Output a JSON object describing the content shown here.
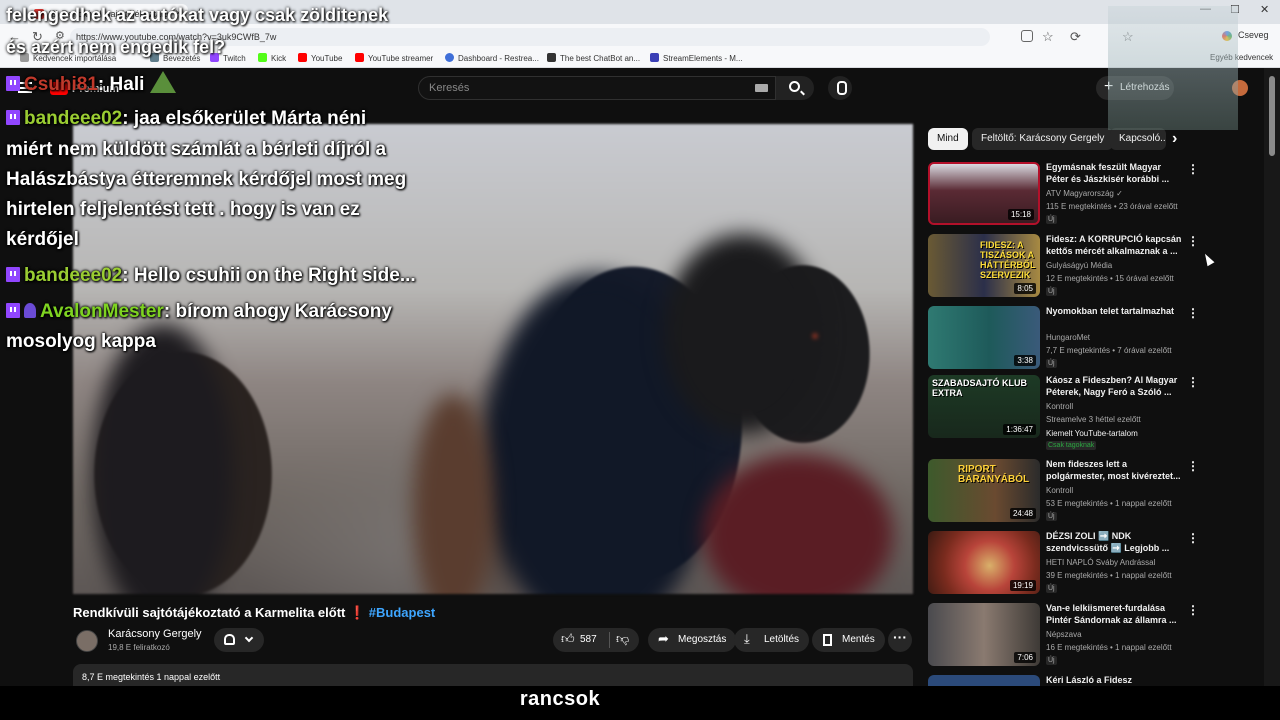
{
  "browser": {
    "tab_title": "(6) Rendkívüli sajtótájékoztató",
    "url": "https://www.youtube.com/watch?v=3uk9CWfB_7w",
    "profile_label": "Cseveg",
    "bookmarks": [
      "Kedvencek importálása",
      "Bevezetés",
      "Twitch",
      "Kick",
      "YouTube",
      "YouTube streamer",
      "Dashboard - Restrea...",
      "The best ChatBot an...",
      "StreamElements - M..."
    ],
    "bookmarks_right": "Egyéb kedvencek"
  },
  "overlay_caption": {
    "line1": "felengedhek az autókat vagy csak zölditenek",
    "line2": "és azért nem engedik fel?"
  },
  "chat": [
    {
      "user": "Csuhi81",
      "user_color": "#c0392b",
      "text": ": Hali",
      "badges": [
        "twitch"
      ],
      "emote": "illuminati"
    },
    {
      "user": "bandeee02",
      "user_color": "#9acd32",
      "text": ": jaa elsőkerület Márta néni",
      "badges": [
        "twitch"
      ],
      "cont": [
        "miért nem küldött számlát a bérleti díjról a",
        "Halászbástya étteremnek kérdőjel most meg",
        "hirtelen feljelentést tett . hogy is van ez",
        "kérdőjel"
      ]
    },
    {
      "user": "bandeee02",
      "user_color": "#9acd32",
      "text": ": Hello csuhii on the Right side...",
      "badges": [
        "twitch"
      ],
      "cont": []
    },
    {
      "user": "AvalonMester",
      "user_color": "#7ed321",
      "text": ": bírom ahogy Karácsony",
      "badges": [
        "twitch",
        "sub"
      ],
      "cont": [
        "mosolyog kappa"
      ]
    }
  ],
  "youtube": {
    "premium_label": "Premium",
    "search_placeholder": "Keresés",
    "create_label": "Létrehozás",
    "video": {
      "title_main": "Rendkívüli sajtótájékoztató a Karmelita előtt",
      "title_excl": "❗",
      "hashtag": "#Budapest",
      "channel_name": "Karácsony Gergely",
      "subscribers": "19,8 E feliratkozó",
      "likes": "587",
      "share_label": "Megosztás",
      "download_label": "Letöltés",
      "save_label": "Mentés",
      "views_line": "8,7 E megtekintés  1 nappal ezelőtt"
    },
    "chips": [
      "Mind",
      "Feltöltő: Karácsony Gergely",
      "Kapcsoló..."
    ],
    "recommendations": [
      {
        "title": "Egymásnak feszült Magyar Péter és Jászkisér korábbi ...",
        "channel": "ATV Magyarország ✓",
        "meta": "115 E megtekintés • 23 órával ezelőtt",
        "badge": "Új",
        "duration": "15:18",
        "thumb_color": "#6a2a34",
        "thumb_text": ""
      },
      {
        "title": "Fidesz: A KORRUPCIÓ kapcsán kettős mércét alkalmaznak a ...",
        "channel": "Gulyáságyú Média",
        "meta": "12 E megtekintés • 15 órával ezelőtt",
        "badge": "Új",
        "duration": "8:05",
        "thumb_color": "#5a4a2e",
        "thumb_text": "FIDESZ: A TISZÁSOK A HÁTTÉRBŐL SZERVEZIK"
      },
      {
        "title": "Nyomokban telet tartalmazhat",
        "channel": "HungaroMet",
        "meta": "7,7 E megtekintés • 7 órával ezelőtt",
        "badge": "Új",
        "duration": "3:38",
        "thumb_color": "#2f6a6a",
        "thumb_text": ""
      },
      {
        "title": "Káosz a Fideszben? Al Magyar Péterek, Nagy Feró a Szóló ...",
        "channel": "Kontroll",
        "meta": "Streamelve 3 héttel ezelőtt",
        "badge": "Kiemelt YouTube-tartalom",
        "badge2": "Csak tagoknak",
        "duration": "1:36:47",
        "thumb_color": "#1e3a26",
        "thumb_text": "SZABADSAJTÓ KLUB EXTRA"
      },
      {
        "title": "Nem fideszes lett a polgármester, most kivéreztet...",
        "channel": "Kontroll",
        "meta": "53 E megtekintés • 1 nappal ezelőtt",
        "badge": "Új",
        "duration": "24:48",
        "thumb_color": "#4a3b2a",
        "thumb_text": "RIPORT BARANYÁBÓL"
      },
      {
        "title": "DÉZSI ZOLI ➡️ NDK szendvicssütő ➡️ Legjobb ...",
        "channel": "HETI NAPLÓ Sváby Andrással",
        "meta": "39 E megtekintés • 1 nappal ezelőtt",
        "badge": "Új",
        "duration": "19:19",
        "thumb_color": "#7a2b1e",
        "thumb_text": ""
      },
      {
        "title": "Van-e lelkiismeret-furdalása Pintér Sándornak az államra ...",
        "channel": "Népszava",
        "meta": "16 E megtekintés • 1 nappal ezelőtt",
        "badge": "Új",
        "duration": "7:06",
        "thumb_color": "#5c4f48",
        "thumb_text": ""
      },
      {
        "title": "Kéri László a Fidesz",
        "channel": "",
        "meta": "",
        "badge": "",
        "duration": "",
        "thumb_color": "#2b4a7a",
        "thumb_text": ""
      }
    ]
  },
  "bottom_caption": "rancsok"
}
